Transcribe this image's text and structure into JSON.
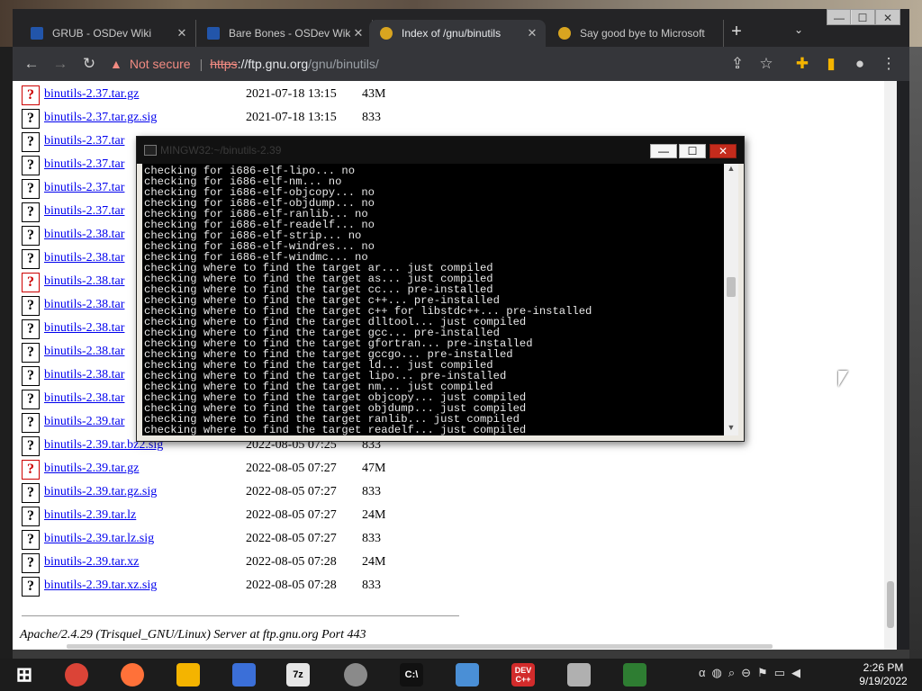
{
  "browser": {
    "tabs": [
      {
        "label": "GRUB - OSDev Wiki",
        "active": false,
        "favicon_color": "#2255aa"
      },
      {
        "label": "Bare Bones - OSDev Wiki",
        "active": false,
        "favicon_color": "#2255aa"
      },
      {
        "label": "Index of /gnu/binutils",
        "active": true,
        "favicon_color": "#d9a520"
      },
      {
        "label": "Say good bye to Microsoft",
        "active": false,
        "favicon_color": "#d9a520"
      }
    ],
    "new_tab": "+",
    "address": {
      "security_label": "Not secure",
      "separator": "|",
      "scheme": "https",
      "host": "://ftp.gnu.org",
      "path": "/gnu/binutils/"
    }
  },
  "listing": {
    "rows": [
      {
        "name": "binutils-2.37.tar.gz",
        "date": "2021-07-18 13:15",
        "size": "43M",
        "archive": true
      },
      {
        "name": "binutils-2.37.tar.gz.sig",
        "date": "2021-07-18 13:15",
        "size": "833",
        "archive": false
      },
      {
        "name": "binutils-2.37.tar",
        "date": "",
        "size": "",
        "archive": false
      },
      {
        "name": "binutils-2.37.tar",
        "date": "",
        "size": "",
        "archive": false
      },
      {
        "name": "binutils-2.37.tar",
        "date": "",
        "size": "",
        "archive": false
      },
      {
        "name": "binutils-2.37.tar",
        "date": "",
        "size": "",
        "archive": false
      },
      {
        "name": "binutils-2.38.tar",
        "date": "",
        "size": "",
        "archive": false
      },
      {
        "name": "binutils-2.38.tar",
        "date": "",
        "size": "",
        "archive": false
      },
      {
        "name": "binutils-2.38.tar",
        "date": "",
        "size": "",
        "archive": true
      },
      {
        "name": "binutils-2.38.tar",
        "date": "",
        "size": "",
        "archive": false
      },
      {
        "name": "binutils-2.38.tar",
        "date": "",
        "size": "",
        "archive": false
      },
      {
        "name": "binutils-2.38.tar",
        "date": "",
        "size": "",
        "archive": false
      },
      {
        "name": "binutils-2.38.tar",
        "date": "",
        "size": "",
        "archive": false
      },
      {
        "name": "binutils-2.38.tar",
        "date": "",
        "size": "",
        "archive": false
      },
      {
        "name": "binutils-2.39.tar",
        "date": "",
        "size": "",
        "archive": false
      },
      {
        "name": "binutils-2.39.tar.bz2.sig",
        "date": "2022-08-05 07:25",
        "size": "833",
        "archive": false
      },
      {
        "name": "binutils-2.39.tar.gz",
        "date": "2022-08-05 07:27",
        "size": "47M",
        "archive": true
      },
      {
        "name": "binutils-2.39.tar.gz.sig",
        "date": "2022-08-05 07:27",
        "size": "833",
        "archive": false
      },
      {
        "name": "binutils-2.39.tar.lz",
        "date": "2022-08-05 07:27",
        "size": "24M",
        "archive": false
      },
      {
        "name": "binutils-2.39.tar.lz.sig",
        "date": "2022-08-05 07:27",
        "size": "833",
        "archive": false
      },
      {
        "name": "binutils-2.39.tar.xz",
        "date": "2022-08-05 07:28",
        "size": "24M",
        "archive": false
      },
      {
        "name": "binutils-2.39.tar.xz.sig",
        "date": "2022-08-05 07:28",
        "size": "833",
        "archive": false
      }
    ],
    "footer": "Apache/2.4.29 (Trisquel_GNU/Linux) Server at ftp.gnu.org Port 443"
  },
  "terminal": {
    "title": "MINGW32:~/binutils-2.39",
    "lines": [
      "checking for i686-elf-lipo... no",
      "checking for i686-elf-nm... no",
      "checking for i686-elf-objcopy... no",
      "checking for i686-elf-objdump... no",
      "checking for i686-elf-ranlib... no",
      "checking for i686-elf-readelf... no",
      "checking for i686-elf-strip... no",
      "checking for i686-elf-windres... no",
      "checking for i686-elf-windmc... no",
      "checking where to find the target ar... just compiled",
      "checking where to find the target as... just compiled",
      "checking where to find the target cc... pre-installed",
      "checking where to find the target c++... pre-installed",
      "checking where to find the target c++ for libstdc++... pre-installed",
      "checking where to find the target dlltool... just compiled",
      "checking where to find the target gcc... pre-installed",
      "checking where to find the target gfortran... pre-installed",
      "checking where to find the target gccgo... pre-installed",
      "checking where to find the target ld... just compiled",
      "checking where to find the target lipo... pre-installed",
      "checking where to find the target nm... just compiled",
      "checking where to find the target objcopy... just compiled",
      "checking where to find the target objdump... just compiled",
      "checking where to find the target ranlib... just compiled",
      "checking where to find the target readelf... just compiled"
    ]
  },
  "taskbar": {
    "apps": [
      {
        "name": "start",
        "label": "",
        "color": "#1c1c1c"
      },
      {
        "name": "chrome",
        "label": "",
        "color": "#db4437"
      },
      {
        "name": "firefox",
        "label": "",
        "color": "#ff7139"
      },
      {
        "name": "file-explorer",
        "label": "",
        "color": "#f4b400"
      },
      {
        "name": "network-tool",
        "label": "",
        "color": "#3b6fd8"
      },
      {
        "name": "7zip",
        "label": "7z",
        "color": "#e6e6e6"
      },
      {
        "name": "disc-burner",
        "label": "",
        "color": "#8a8a8a"
      },
      {
        "name": "terminal",
        "label": "C:\\",
        "color": "#111111"
      },
      {
        "name": "calculator",
        "label": "",
        "color": "#4a8fd6"
      },
      {
        "name": "devcpp",
        "label": "DEV C++",
        "color": "#d22b2b"
      },
      {
        "name": "package-tool",
        "label": "",
        "color": "#b0b0b0"
      },
      {
        "name": "notepad",
        "label": "",
        "color": "#2e7d32"
      }
    ],
    "clock_time": "2:26 PM",
    "clock_date": "9/19/2022"
  }
}
